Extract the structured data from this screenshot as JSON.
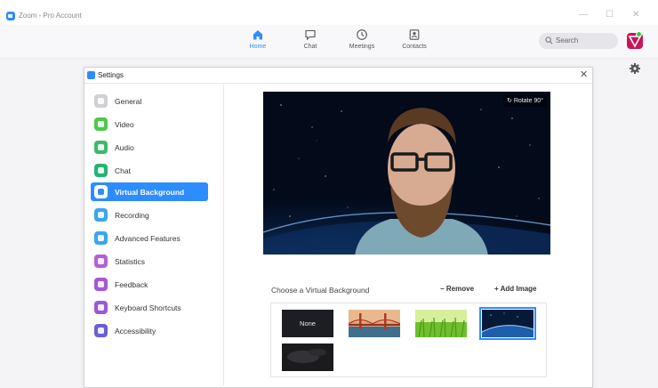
{
  "app": {
    "title": "Zoom - Pro Account",
    "window_controls": [
      "—",
      "☐",
      "✕"
    ]
  },
  "topnav": {
    "tabs": [
      {
        "label": "Home",
        "icon": "home-icon",
        "active": true
      },
      {
        "label": "Chat",
        "icon": "chat-icon",
        "active": false
      },
      {
        "label": "Meetings",
        "icon": "clock-icon",
        "active": false
      },
      {
        "label": "Contacts",
        "icon": "contacts-icon",
        "active": false
      }
    ],
    "search_placeholder": "Search",
    "accent_color": "#2d8cff",
    "avatar_color": "#c8155a"
  },
  "settings": {
    "title": "Settings",
    "close_glyph": "✕",
    "sidebar": [
      {
        "label": "General",
        "icon": "gear-icon",
        "color": "#cfcfd4"
      },
      {
        "label": "Video",
        "icon": "video-camera-icon",
        "color": "#4cc94c"
      },
      {
        "label": "Audio",
        "icon": "headphones-icon",
        "color": "#3cba6c"
      },
      {
        "label": "Chat",
        "icon": "chat-bubble-icon",
        "color": "#22b573"
      },
      {
        "label": "Virtual Background",
        "icon": "person-icon",
        "color": "#2d8cff",
        "active": true
      },
      {
        "label": "Recording",
        "icon": "record-icon",
        "color": "#3aa6f0"
      },
      {
        "label": "Advanced Features",
        "icon": "sparkle-icon",
        "color": "#3aa6f0"
      },
      {
        "label": "Statistics",
        "icon": "bar-chart-icon",
        "color": "#b35fd6"
      },
      {
        "label": "Feedback",
        "icon": "feedback-icon",
        "color": "#a35ad6"
      },
      {
        "label": "Keyboard Shortcuts",
        "icon": "keyboard-icon",
        "color": "#9a5ad6"
      },
      {
        "label": "Accessibility",
        "icon": "accessibility-icon",
        "color": "#6b5fd6"
      }
    ],
    "virtual_background": {
      "rotate_label": "Rotate 90°",
      "choose_label": "Choose a Virtual Background",
      "remove_label": "− Remove",
      "add_image_label": "+ Add Image",
      "thumbnails": [
        {
          "name": "thumb-none",
          "label": "None",
          "selected": false
        },
        {
          "name": "thumb-golden-gate",
          "label": "",
          "selected": false
        },
        {
          "name": "thumb-grass",
          "label": "",
          "selected": false
        },
        {
          "name": "thumb-earth-space",
          "label": "",
          "selected": true
        },
        {
          "name": "thumb-dark-custom",
          "label": "",
          "selected": false
        }
      ]
    }
  }
}
